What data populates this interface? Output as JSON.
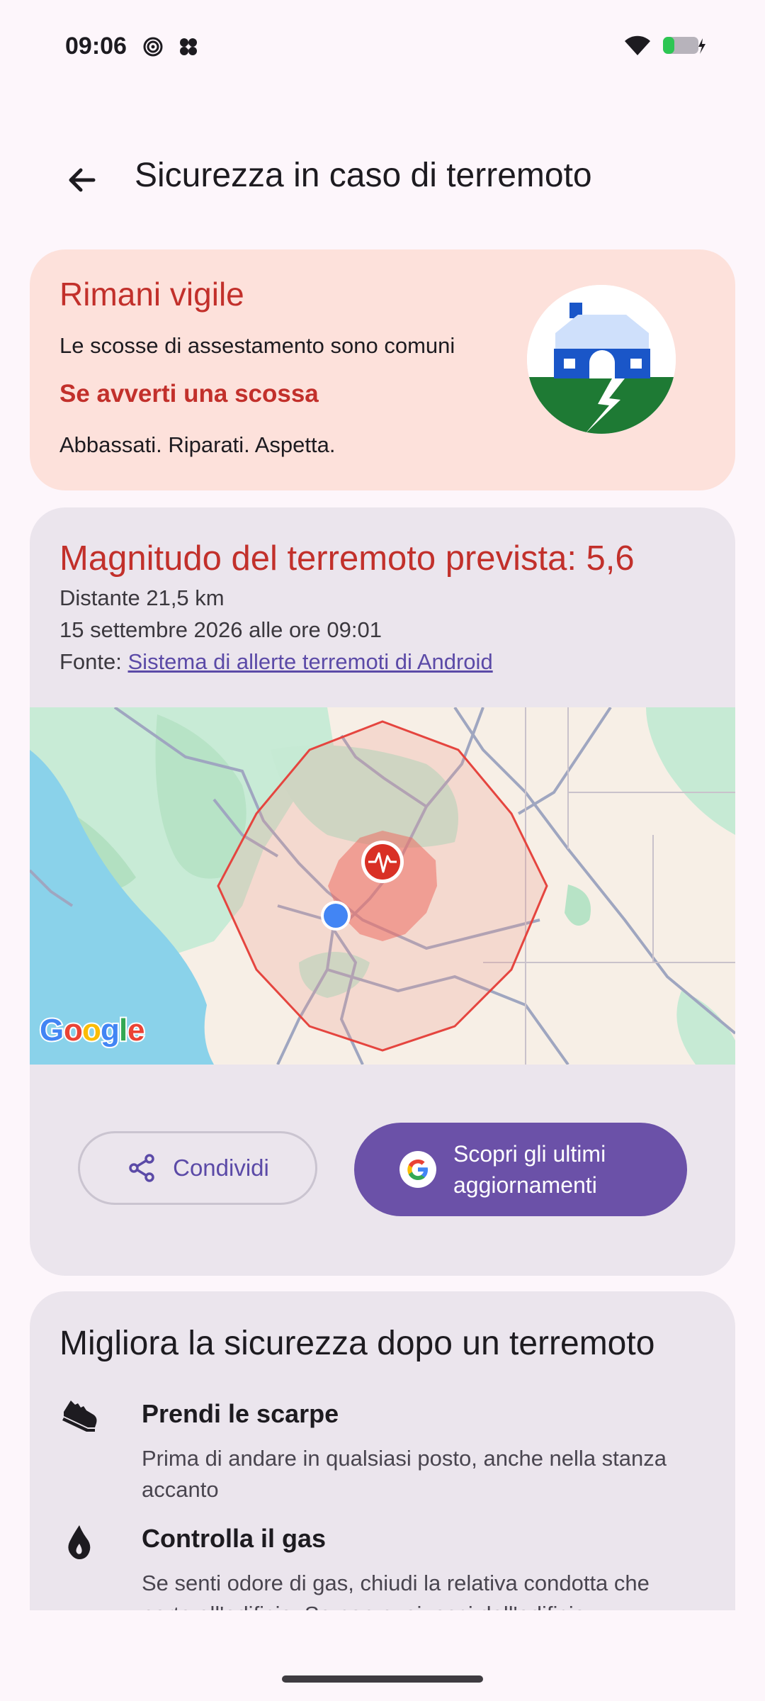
{
  "status_bar": {
    "time": "09:06"
  },
  "app_bar": {
    "title": "Sicurezza in caso di terremoto"
  },
  "alert_card": {
    "title": "Rimani vigile",
    "subtitle": "Le scosse di assestamento sono comuni",
    "action_title": "Se avverti una scossa",
    "steps": "Abbassati. Riparati. Aspetta."
  },
  "quake_card": {
    "title": "Magnitudo del terremoto prevista: 5,6",
    "distance": "Distante 21,5 km",
    "datetime": "15 settembre 2026 alle ore 09:01",
    "source_label": "Fonte: ",
    "source_link": "Sistema di allerte terremoti di Android",
    "map_brand": "Google",
    "share_label": "Condividi",
    "updates_label": "Scopri gli ultimi aggiornamenti"
  },
  "safety_card": {
    "title": "Migliora la sicurezza dopo un terremoto",
    "tips": [
      {
        "icon": "shoe-icon",
        "title": "Prendi le scarpe",
        "body": "Prima di andare in qualsiasi posto, anche nella stanza accanto"
      },
      {
        "icon": "gas-flame-icon",
        "title": "Controlla il gas",
        "body": "Se senti odore di gas, chiudi la relativa condotta che porta all'edificio. Se non puoi, esci dall'edificio"
      }
    ]
  },
  "colors": {
    "accent_red": "#c2302b",
    "accent_purple": "#6b51a8",
    "alert_bg": "#fde1db",
    "card_bg": "#ebe5ed",
    "page_bg": "#fdf6fb"
  }
}
